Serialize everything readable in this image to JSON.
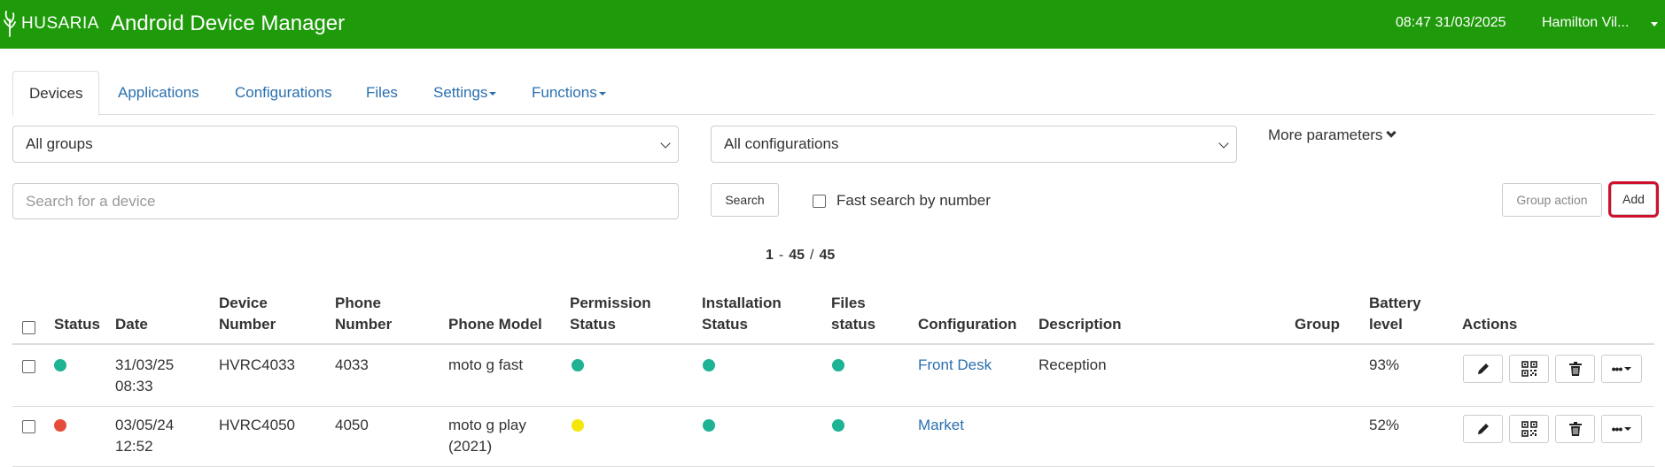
{
  "header": {
    "logo_text": "HUSARIA",
    "title": "Android Device Manager",
    "datetime": "08:47 31/03/2025",
    "user": "Hamilton Vil..."
  },
  "tabs": [
    {
      "label": "Devices",
      "active": true
    },
    {
      "label": "Applications",
      "active": false
    },
    {
      "label": "Configurations",
      "active": false
    },
    {
      "label": "Files",
      "active": false
    },
    {
      "label": "Settings",
      "active": false,
      "dropdown": true
    },
    {
      "label": "Functions",
      "active": false,
      "dropdown": true
    }
  ],
  "filters": {
    "group_select": "All groups",
    "config_select": "All configurations",
    "more_parameters": "More parameters"
  },
  "search": {
    "placeholder": "Search for a device",
    "value": "",
    "button": "Search",
    "fast_search_label": "Fast search by number",
    "fast_search_checked": false,
    "group_action_button": "Group action",
    "add_button": "Add"
  },
  "pagination": {
    "from": "1",
    "to": "45",
    "separator": "-",
    "total_separator": "/",
    "total": "45"
  },
  "table": {
    "headers": {
      "status": "Status",
      "date": "Date",
      "device_number": [
        "Device",
        "Number"
      ],
      "phone_number": [
        "Phone",
        "Number"
      ],
      "phone_model": "Phone Model",
      "permission_status": [
        "Permission",
        "Status"
      ],
      "installation_status": [
        "Installation",
        "Status"
      ],
      "files_status": [
        "Files",
        "status"
      ],
      "configuration": "Configuration",
      "description": "Description",
      "group": "Group",
      "battery_level": [
        "Battery",
        "level"
      ],
      "actions": "Actions"
    },
    "rows": [
      {
        "status_color": "#1db394",
        "date": [
          "31/03/25",
          "08:33"
        ],
        "device_number": "HVRC4033",
        "phone_number": "4033",
        "phone_model": [
          "moto g fast",
          ""
        ],
        "permission_color": "#1db394",
        "installation_color": "#1db394",
        "files_color": "#1db394",
        "configuration": "Front Desk",
        "description": "Reception",
        "group": "",
        "battery": "93%"
      },
      {
        "status_color": "#e64c3c",
        "date": [
          "03/05/24",
          "12:52"
        ],
        "device_number": "HVRC4050",
        "phone_number": "4050",
        "phone_model": [
          "moto g play",
          "(2021)"
        ],
        "permission_color": "#f5e60a",
        "installation_color": "#1db394",
        "files_color": "#1db394",
        "configuration": "Market",
        "description": "",
        "group": "",
        "battery": "52%"
      }
    ],
    "action_icons": [
      "edit-icon",
      "qr-code-icon",
      "trash-icon",
      "more-icon"
    ]
  },
  "colors": {
    "header_bg": "#1f9a0a",
    "link": "#2a6fb0",
    "highlight": "#d0102c"
  }
}
